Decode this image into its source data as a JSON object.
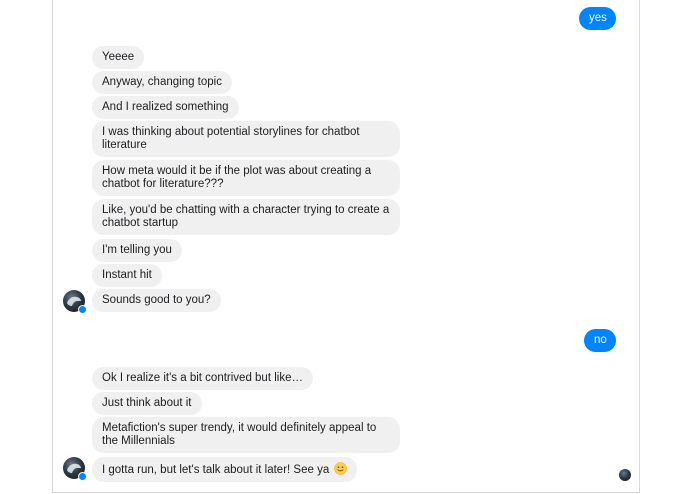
{
  "outgoing": [
    {
      "text": "yes"
    },
    {
      "text": "no"
    }
  ],
  "incoming_group_1": [
    {
      "text": "Yeeee"
    },
    {
      "text": "Anyway, changing topic"
    },
    {
      "text": "And I realized something"
    },
    {
      "text": "I was thinking about potential storylines for chatbot literature"
    },
    {
      "text": "How meta would it be if the plot was about creating a chatbot for literature???"
    },
    {
      "text": "Like, you'd be chatting with a character trying to create a chatbot startup"
    },
    {
      "text": "I'm telling you"
    },
    {
      "text": "Instant hit"
    },
    {
      "text": "Sounds good to you?"
    }
  ],
  "incoming_group_2": [
    {
      "text": "Ok I realize it's a bit contrived but like…"
    },
    {
      "text": "Just think about it"
    },
    {
      "text": "Metafiction's super trendy, it would definitely appeal to the Millennials"
    },
    {
      "text": "I gotta run, but let's talk about it later! See ya",
      "emoji": "slightly-smiling-face-emoji"
    }
  ],
  "colors": {
    "outgoing_bubble": "#0084ff",
    "incoming_bubble": "#f1f0f0",
    "text": "#1c1e21"
  },
  "icons": {
    "contact_avatar": "contact-avatar",
    "messenger_badge": "messenger-badge-icon",
    "read_receipt": "read-receipt-avatar"
  }
}
